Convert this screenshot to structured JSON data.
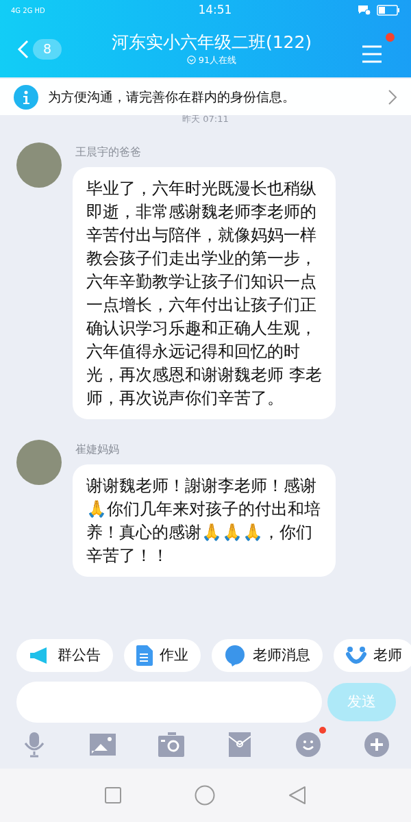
{
  "status_bar": {
    "network": "4G 2G HD",
    "time": "14:51"
  },
  "header": {
    "back_count": "8",
    "title": "河东实小六年级二班(122)",
    "online": "91人在线",
    "menu_badge": true
  },
  "notice": {
    "text": "为方便沟通，请完善你在群内的身份信息。"
  },
  "timestamp": "昨天 07:11",
  "messages": [
    {
      "sender": "王晨宇的爸爸",
      "text": "毕业了，六年时光既漫长也稍纵即逝，非常感谢魏老师李老师的辛苦付出与陪伴，就像妈妈一样教会孩子们走出学业的第一步，六年辛勤教学让孩子们知识一点一点增长，六年付出让孩子们正确认识学习乐趣和正确人生观，六年值得永远记得和回忆的时光，再次感恩和谢谢魏老师  李老师，再次说声你们辛苦了。"
    },
    {
      "sender": "崔婕妈妈",
      "text": "谢谢魏老师！謝谢李老师！感谢🙏你们几年来对孩子的付出和培养！真心的感谢🙏🙏🙏，你们辛苦了！！"
    }
  ],
  "shortcuts": [
    {
      "kind": "announce",
      "label": "群公告"
    },
    {
      "kind": "homework",
      "label": "作业"
    },
    {
      "kind": "teacher",
      "label": "老师消息"
    },
    {
      "kind": "assistant",
      "label": "老师"
    }
  ],
  "input": {
    "send": "发送"
  },
  "toolbar": [
    {
      "kind": "mic",
      "badge": false
    },
    {
      "kind": "image",
      "badge": false
    },
    {
      "kind": "camera",
      "badge": false
    },
    {
      "kind": "redpacket",
      "badge": false
    },
    {
      "kind": "emoji",
      "badge": true
    },
    {
      "kind": "plus",
      "badge": false
    }
  ]
}
